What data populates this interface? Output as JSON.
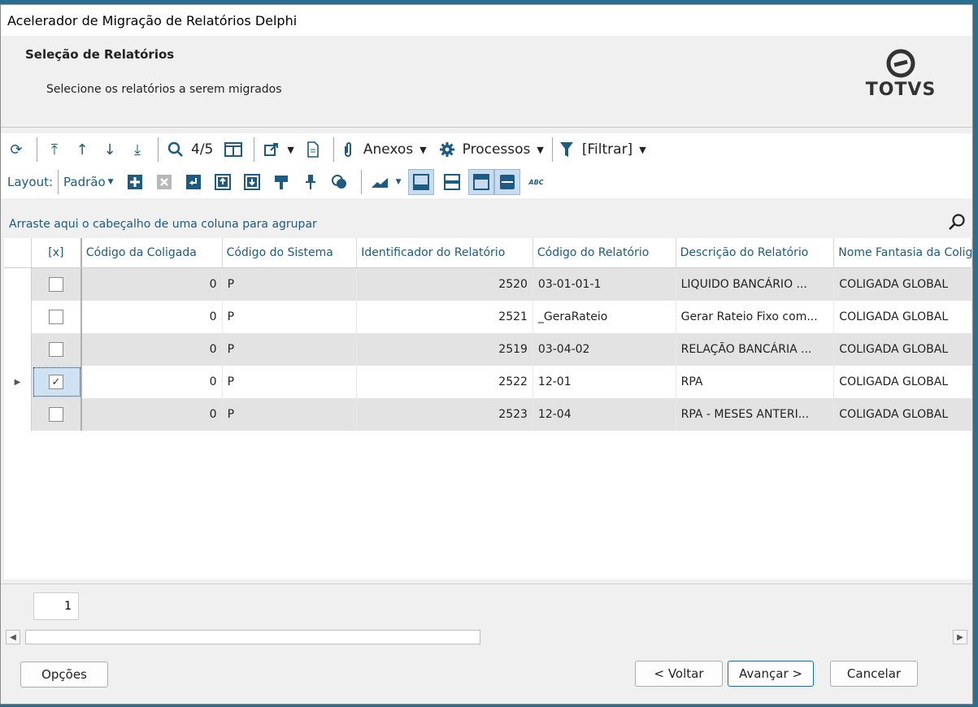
{
  "window": {
    "title": "Acelerador de Migração de Relatórios Delphi"
  },
  "header": {
    "title": "Seleção de Relatórios",
    "subtitle": "Selecione os relatórios a serem migrados",
    "logo_text": "TOTVS"
  },
  "toolbar": {
    "record_counter": "4/5",
    "anexos_label": "Anexos",
    "processos_label": "Processos",
    "filtrar_label": "[Filtrar]",
    "layout_label": "Layout:",
    "layout_value": "Padrão",
    "abc_label": "ABC"
  },
  "group_area": {
    "hint": "Arraste aqui o cabeçalho de uma coluna para agrupar"
  },
  "grid": {
    "columns": [
      "[x]",
      "Código da Coligada",
      "Código do Sistema",
      "Identificador do Relatório",
      "Código do Relatório",
      "Descrição do Relatório",
      "Nome Fantasia da Coligada"
    ],
    "rows": [
      {
        "checked": false,
        "coligada": "0",
        "sistema": "P",
        "id": "2520",
        "codigo": "03-01-01-1",
        "descricao": " LIQUIDO BANCÁRIO ...",
        "fantasia": "COLIGADA GLOBAL"
      },
      {
        "checked": false,
        "coligada": "0",
        "sistema": "P",
        "id": "2521",
        "codigo": "_GeraRateio",
        "descricao": "Gerar Rateio Fixo com...",
        "fantasia": "COLIGADA GLOBAL"
      },
      {
        "checked": false,
        "coligada": "0",
        "sistema": "P",
        "id": "2519",
        "codigo": "03-04-02",
        "descricao": "RELAÇÃO BANCÁRIA ...",
        "fantasia": "COLIGADA GLOBAL"
      },
      {
        "checked": true,
        "coligada": "0",
        "sistema": "P",
        "id": "2522",
        "codigo": "12-01",
        "descricao": "RPA",
        "fantasia": "COLIGADA GLOBAL"
      },
      {
        "checked": false,
        "coligada": "0",
        "sistema": "P",
        "id": "2523",
        "codigo": "12-04",
        "descricao": "RPA - MESES ANTERI...",
        "fantasia": "COLIGADA GLOBAL"
      }
    ]
  },
  "pager": {
    "page": "1"
  },
  "footer": {
    "options_label": "Opções",
    "back_label": "< Voltar",
    "next_label": "Avançar >",
    "cancel_label": "Cancelar"
  },
  "colors": {
    "accent": "#1d5b80",
    "alt_row": "#e3e3e3"
  }
}
